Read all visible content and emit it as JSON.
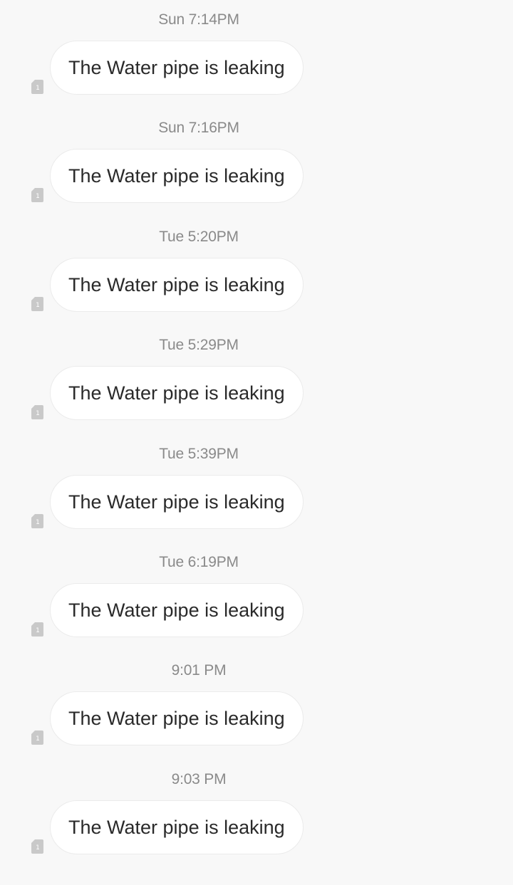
{
  "messages": [
    {
      "time": "Sun 7:14PM",
      "text": "The Water pipe is leaking",
      "sim": "1"
    },
    {
      "time": "Sun 7:16PM",
      "text": "The Water pipe is leaking",
      "sim": "1"
    },
    {
      "time": "Tue 5:20PM",
      "text": "The Water pipe is leaking",
      "sim": "1"
    },
    {
      "time": "Tue 5:29PM",
      "text": "The Water pipe is leaking",
      "sim": "1"
    },
    {
      "time": "Tue 5:39PM",
      "text": "The Water pipe is leaking",
      "sim": "1"
    },
    {
      "time": "Tue 6:19PM",
      "text": "The Water pipe is leaking",
      "sim": "1"
    },
    {
      "time": "9:01 PM",
      "text": "The Water pipe is leaking",
      "sim": "1"
    },
    {
      "time": "9:03 PM",
      "text": "The Water pipe is leaking",
      "sim": "1"
    }
  ],
  "icons": {
    "sim": "sim-card-icon"
  },
  "colors": {
    "background": "#f8f8f8",
    "bubble": "#ffffff",
    "bubble_text": "#2a2a2a",
    "timestamp": "#8a8a8a",
    "sim_icon": "#c9c9c9"
  }
}
